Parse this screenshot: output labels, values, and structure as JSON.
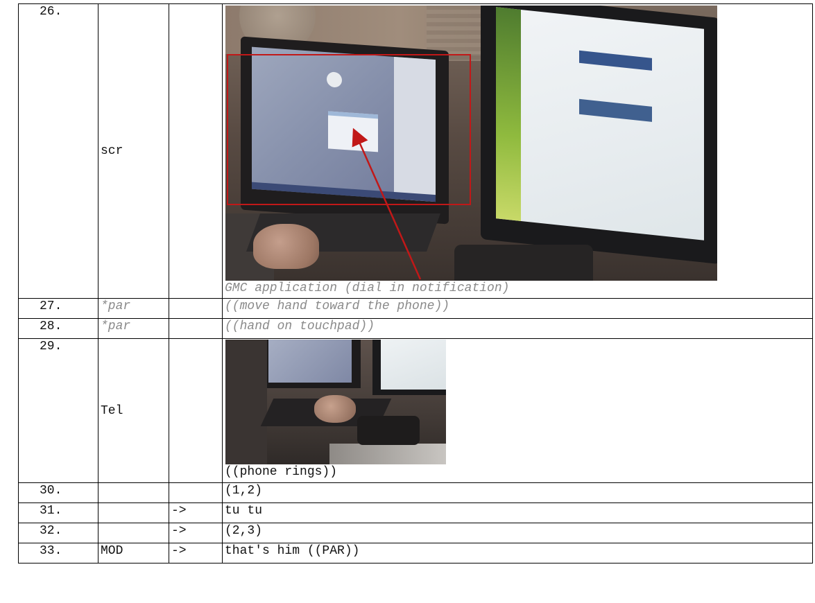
{
  "rows": [
    {
      "num": "26.",
      "speaker": "scr",
      "arrow": "",
      "text": "GMC application (dial in notification)"
    },
    {
      "num": "27.",
      "speaker": "*par",
      "arrow": "",
      "text": "((move hand toward the phone))"
    },
    {
      "num": "28.",
      "speaker": "*par",
      "arrow": "",
      "text": "((hand on touchpad))"
    },
    {
      "num": "29.",
      "speaker": "Tel",
      "arrow": "",
      "text": "((phone rings))"
    },
    {
      "num": "30.",
      "speaker": "",
      "arrow": "",
      "text": "(1,2)"
    },
    {
      "num": "31.",
      "speaker": "",
      "arrow": "->",
      "text": "tu tu"
    },
    {
      "num": "32.",
      "speaker": "",
      "arrow": "->",
      "text": "(2,3)"
    },
    {
      "num": "33.",
      "speaker": "MOD",
      "arrow": "->",
      "text": "that's him ((PAR))"
    }
  ],
  "colors": {
    "annotation_box": "#c11818",
    "annotation_arrow": "#c11818",
    "grey_text": "#8a8a8a"
  }
}
